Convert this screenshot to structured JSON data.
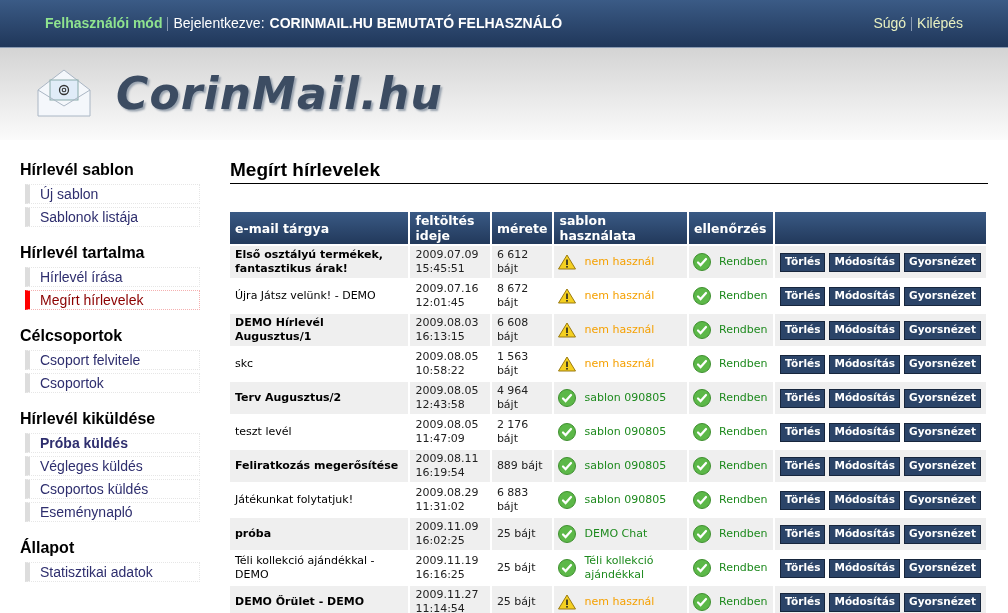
{
  "top_bar": {
    "mode": "Felhasználói mód",
    "logged_in_label": "Bejelentkezve:",
    "user": "CORINMAIL.HU BEMUTATÓ FELHASZNÁLÓ",
    "links": [
      "Súgó",
      "Kilépés"
    ]
  },
  "logo": {
    "text": "CorinMail.hu"
  },
  "sidebar": [
    {
      "heading": "Hírlevél sablon",
      "items": [
        {
          "label": "Új sablon",
          "selected": false,
          "bold": false
        },
        {
          "label": "Sablonok listája",
          "selected": false,
          "bold": false
        }
      ]
    },
    {
      "heading": "Hírlevél tartalma",
      "items": [
        {
          "label": "Hírlevél írása",
          "selected": false,
          "bold": false
        },
        {
          "label": "Megírt hírlevelek",
          "selected": true,
          "bold": false
        }
      ]
    },
    {
      "heading": "Célcsoportok",
      "items": [
        {
          "label": "Csoport felvitele",
          "selected": false,
          "bold": false
        },
        {
          "label": "Csoportok",
          "selected": false,
          "bold": false
        }
      ]
    },
    {
      "heading": "Hírlevél kiküldése",
      "items": [
        {
          "label": "Próba küldés",
          "selected": false,
          "bold": true
        },
        {
          "label": "Végleges küldés",
          "selected": false,
          "bold": false
        },
        {
          "label": "Csoportos küldés",
          "selected": false,
          "bold": false
        },
        {
          "label": "Eseménynapló",
          "selected": false,
          "bold": false
        }
      ]
    },
    {
      "heading": "Állapot",
      "items": [
        {
          "label": "Statisztikai adatok",
          "selected": false,
          "bold": false
        }
      ]
    }
  ],
  "page_title": "Megírt hírlevelek",
  "table": {
    "columns": [
      "e-mail tárgya",
      "feltöltés ideje",
      "mérete",
      "sablon használata",
      "ellenőrzés",
      ""
    ],
    "rows": [
      {
        "subject": "Első osztályú termékek, fantasztikus árak!",
        "date": "2009.07.09 15:45:51",
        "size": "6 612 bájt",
        "template": {
          "kind": "warning",
          "text": "nem használ"
        },
        "check": {
          "kind": "ok",
          "text": "Rendben"
        },
        "actions": [
          "Törlés",
          "Módosítás",
          "Gyorsnézet"
        ]
      },
      {
        "subject": "Újra Játsz velünk! - DEMO",
        "date": "2009.07.16 12:01:45",
        "size": "8 672 bájt",
        "template": {
          "kind": "warning",
          "text": "nem használ"
        },
        "check": {
          "kind": "ok",
          "text": "Rendben"
        },
        "actions": [
          "Törlés",
          "Módosítás",
          "Gyorsnézet"
        ]
      },
      {
        "subject": "DEMO Hírlevél Augusztus/1",
        "date": "2009.08.03 16:13:15",
        "size": "6 608 bájt",
        "template": {
          "kind": "warning",
          "text": "nem használ"
        },
        "check": {
          "kind": "ok",
          "text": "Rendben"
        },
        "actions": [
          "Törlés",
          "Módosítás",
          "Gyorsnézet"
        ]
      },
      {
        "subject": "skc",
        "date": "2009.08.05 10:58:22",
        "size": "1 563 bájt",
        "template": {
          "kind": "warning",
          "text": "nem használ"
        },
        "check": {
          "kind": "ok",
          "text": "Rendben"
        },
        "actions": [
          "Törlés",
          "Módosítás",
          "Gyorsnézet"
        ]
      },
      {
        "subject": "Terv Augusztus/2",
        "date": "2009.08.05 12:43:58",
        "size": "4 964 bájt",
        "template": {
          "kind": "ok",
          "text": "sablon 090805"
        },
        "check": {
          "kind": "ok",
          "text": "Rendben"
        },
        "actions": [
          "Törlés",
          "Módosítás",
          "Gyorsnézet"
        ]
      },
      {
        "subject": "teszt levél",
        "date": "2009.08.05 11:47:09",
        "size": "2 176 bájt",
        "template": {
          "kind": "ok",
          "text": "sablon 090805"
        },
        "check": {
          "kind": "ok",
          "text": "Rendben"
        },
        "actions": [
          "Törlés",
          "Módosítás",
          "Gyorsnézet"
        ]
      },
      {
        "subject": "Feliratkozás megerősítése",
        "date": "2009.08.11 16:19:54",
        "size": "889 bájt",
        "template": {
          "kind": "ok",
          "text": "sablon 090805"
        },
        "check": {
          "kind": "ok",
          "text": "Rendben"
        },
        "actions": [
          "Törlés",
          "Módosítás",
          "Gyorsnézet"
        ]
      },
      {
        "subject": "Játékunkat folytatjuk!",
        "date": "2009.08.29 11:31:02",
        "size": "6 883 bájt",
        "template": {
          "kind": "ok",
          "text": "sablon 090805"
        },
        "check": {
          "kind": "ok",
          "text": "Rendben"
        },
        "actions": [
          "Törlés",
          "Módosítás",
          "Gyorsnézet"
        ]
      },
      {
        "subject": "próba",
        "date": "2009.11.09 16:02:25",
        "size": "25 bájt",
        "template": {
          "kind": "ok",
          "text": "DEMO Chat"
        },
        "check": {
          "kind": "ok",
          "text": "Rendben"
        },
        "actions": [
          "Törlés",
          "Módosítás",
          "Gyorsnézet"
        ]
      },
      {
        "subject": "Téli kollekció ajándékkal - DEMO",
        "date": "2009.11.19 16:16:25",
        "size": "25 bájt",
        "template": {
          "kind": "ok",
          "text": "Téli kollekció ajándékkal"
        },
        "check": {
          "kind": "ok",
          "text": "Rendben"
        },
        "actions": [
          "Törlés",
          "Módosítás",
          "Gyorsnézet"
        ]
      },
      {
        "subject": "DEMO Őrület - DEMO",
        "date": "2009.11.27 11:14:54",
        "size": "25 bájt",
        "template": {
          "kind": "warning",
          "text": "nem használ"
        },
        "check": {
          "kind": "ok",
          "text": "Rendben"
        },
        "actions": [
          "Törlés",
          "Módosítás",
          "Gyorsnézet"
        ]
      }
    ]
  }
}
